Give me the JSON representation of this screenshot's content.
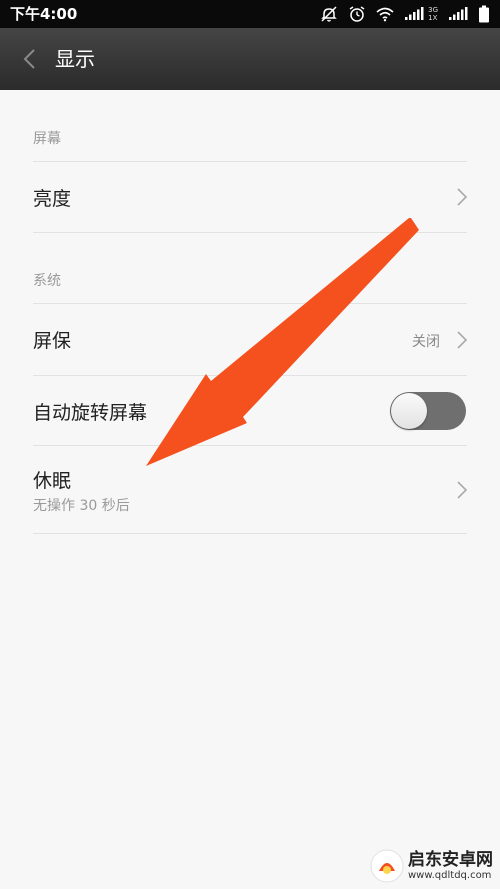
{
  "status_bar": {
    "time": "下午4:00",
    "network_top": "3G",
    "network_bottom": "1X"
  },
  "header": {
    "title": "显示"
  },
  "sections": {
    "screen": {
      "title": "屏幕",
      "brightness_label": "亮度"
    },
    "system": {
      "title": "系统",
      "screensaver_label": "屏保",
      "screensaver_value": "关闭",
      "autorotate_label": "自动旋转屏幕",
      "autorotate_on": false,
      "sleep_label": "休眠",
      "sleep_sub": "无操作 30 秒后"
    }
  },
  "colors": {
    "arrow": "#f4511e",
    "toggle_off": "#6f6f6f",
    "header": "#3a3a3a"
  },
  "watermark": {
    "name": "启东安卓网",
    "url": "www.qdltdq.com"
  }
}
